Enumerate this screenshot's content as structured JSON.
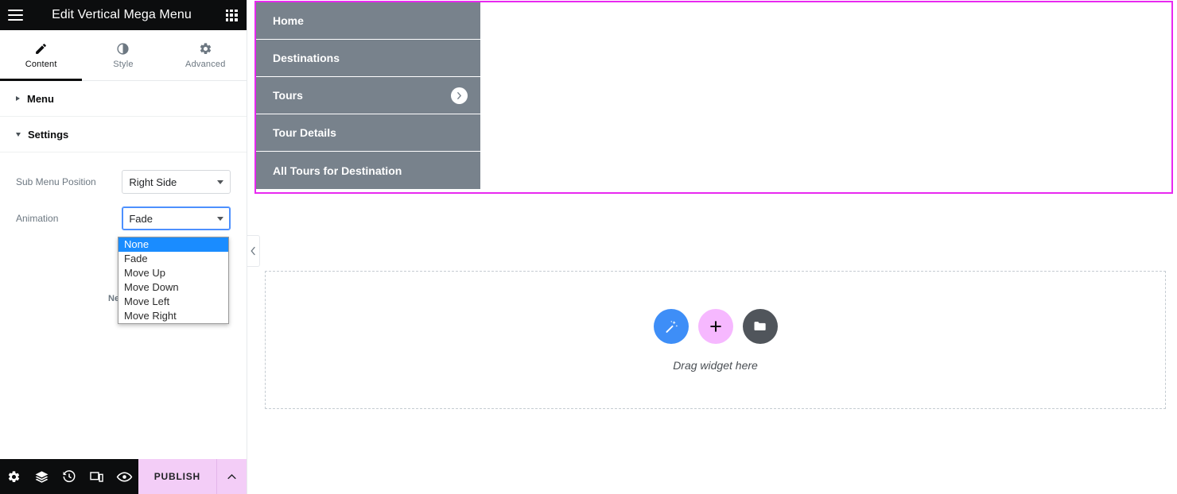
{
  "panel": {
    "header": {
      "title": "Edit Vertical Mega Menu",
      "menu_icon": "hamburger-icon",
      "apps_icon": "grid-apps-icon"
    },
    "tabs": [
      {
        "label": "Content",
        "icon": "pencil-icon",
        "active": true
      },
      {
        "label": "Style",
        "icon": "half-circle-contrast-icon",
        "active": false
      },
      {
        "label": "Advanced",
        "icon": "gear-icon",
        "active": false
      }
    ],
    "sections": [
      {
        "title": "Menu",
        "expanded": false
      },
      {
        "title": "Settings",
        "expanded": true
      }
    ],
    "controls": {
      "sub_menu_position": {
        "label": "Sub Menu Position",
        "value": "Right Side"
      },
      "animation": {
        "label": "Animation",
        "value": "Fade",
        "open": true,
        "options": [
          {
            "label": "None",
            "selected": true
          },
          {
            "label": "Fade",
            "selected": false
          },
          {
            "label": "Move Up",
            "selected": false
          },
          {
            "label": "Move Down",
            "selected": false
          },
          {
            "label": "Move Left",
            "selected": false
          },
          {
            "label": "Move Right",
            "selected": false
          }
        ]
      }
    },
    "need_help": "Need H",
    "footer": {
      "icons": [
        "gear-settings-icon",
        "layers-navigator-icon",
        "history-clock-icon",
        "responsive-mode-icon",
        "preview-eye-icon"
      ],
      "publish_label": "PUBLISH",
      "publish_caret_icon": "chevron-up-icon",
      "publish_color": "#f3cdf7"
    },
    "collapse_handle_icon": "chevron-left-icon"
  },
  "canvas": {
    "selection_color": "#e829f0",
    "menu_background": "#78828c",
    "menu_items": [
      {
        "label": "Home",
        "has_submenu": false
      },
      {
        "label": "Destinations",
        "has_submenu": false
      },
      {
        "label": "Tours",
        "has_submenu": true,
        "submenu_icon": "chevron-right-circle-icon"
      },
      {
        "label": "Tour Details",
        "has_submenu": false
      },
      {
        "label": "All Tours for Destination",
        "has_submenu": false
      }
    ],
    "dropzone": {
      "label": "Drag widget here",
      "buttons": [
        {
          "icon": "magic-wand-icon",
          "color": "#3e8ef7"
        },
        {
          "icon": "plus-icon",
          "color": "#f6b8ff"
        },
        {
          "icon": "folder-icon",
          "color": "#50555b"
        }
      ]
    }
  }
}
